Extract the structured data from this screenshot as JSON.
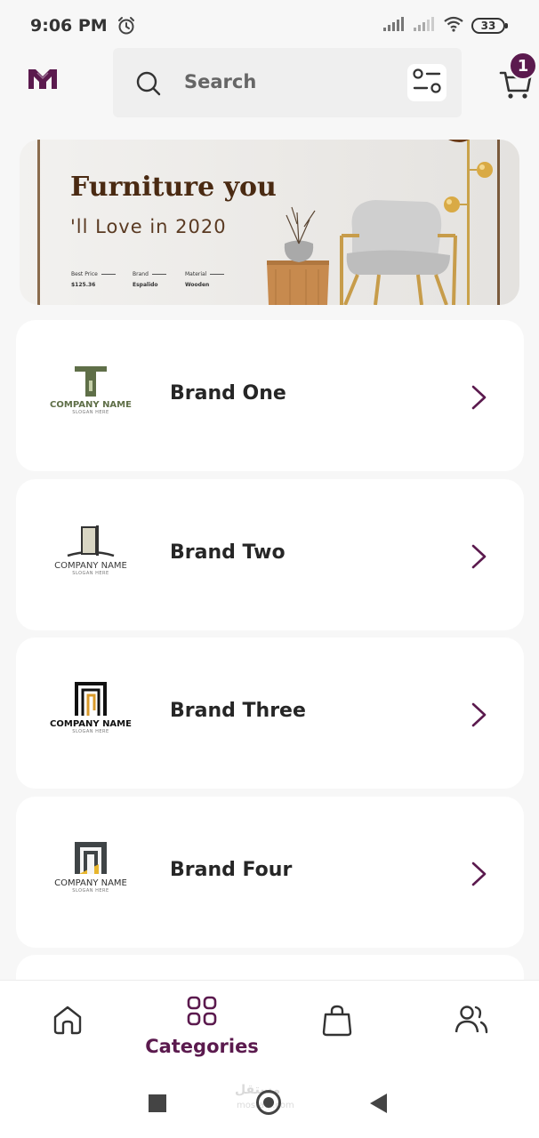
{
  "status_bar": {
    "time": "9:06 PM",
    "battery": "33",
    "icons": [
      "alarm-icon",
      "signal-icon",
      "signal-icon",
      "wifi-icon",
      "battery-icon"
    ]
  },
  "header": {
    "logo_icon": "brand-logo-icon",
    "search": {
      "placeholder": "Search",
      "icon": "search-icon"
    },
    "filter_icon": "sliders-icon",
    "cart": {
      "icon": "cart-icon",
      "badge": "1"
    }
  },
  "banner": {
    "title": "Furniture you",
    "subtitle": "'ll Love in 2020",
    "specs": [
      {
        "label": "Best Price",
        "value": "$125.36"
      },
      {
        "label": "Brand",
        "value": "Espalido"
      },
      {
        "label": "Material",
        "value": "Wooden"
      }
    ]
  },
  "brands": [
    {
      "name": "Brand One",
      "logo_company": "COMPANY NAME",
      "logo_slogan": "SLOGAN HERE",
      "logo_color": "#5f6f48"
    },
    {
      "name": "Brand Two",
      "logo_company": "COMPANY NAME",
      "logo_slogan": "SLOGAN HERE",
      "logo_color": "#3a3a3a"
    },
    {
      "name": "Brand Three",
      "logo_company": "COMPANY NAME",
      "logo_slogan": "SLOGAN HERE",
      "logo_color": "#111111"
    },
    {
      "name": "Brand Four",
      "logo_company": "COMPANY NAME",
      "logo_slogan": "SLOGAN HERE",
      "logo_color": "#2e2e2e"
    }
  ],
  "bottom_nav": {
    "items": [
      {
        "id": "home",
        "icon": "home-icon",
        "label": ""
      },
      {
        "id": "categories",
        "icon": "categories-icon",
        "label": "Categories",
        "active": true
      },
      {
        "id": "bag",
        "icon": "shopping-bag-icon",
        "label": ""
      },
      {
        "id": "profile",
        "icon": "users-icon",
        "label": ""
      }
    ]
  },
  "system_nav": {
    "icons": [
      "recents-icon",
      "home-circle-icon",
      "back-icon"
    ],
    "watermark": "مستقل",
    "watermark_sub": "mostaql.com"
  },
  "colors": {
    "accent": "#5b1a4e",
    "background": "#f7f7f7",
    "card": "#ffffff",
    "banner_text": "#4a2a12"
  }
}
